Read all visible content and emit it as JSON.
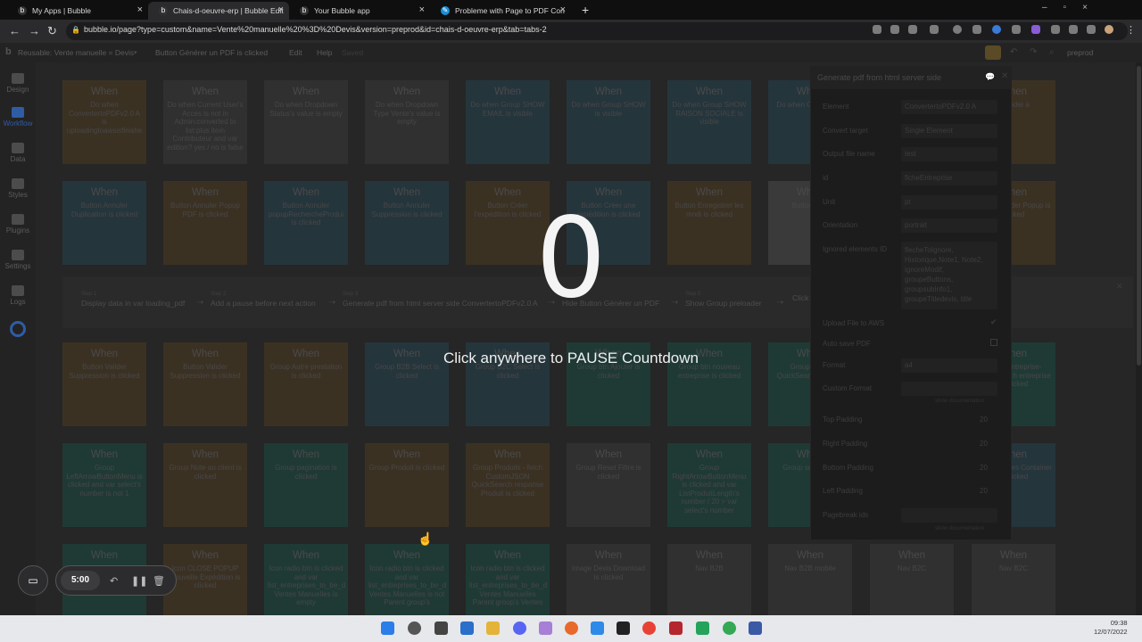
{
  "browser": {
    "tabs": [
      {
        "title": "My Apps | Bubble",
        "icon": "bubble-icon"
      },
      {
        "title": "Chais-d-oeuvre-erp | Bubble Edit",
        "icon": "bubble-icon"
      },
      {
        "title": "Your Bubble app",
        "icon": "bubble-icon"
      },
      {
        "title": "Probleme with Page to PDF Con",
        "icon": "forum-icon"
      }
    ],
    "url": "bubble.io/page?type=custom&name=Vente%20manuelle%20%3D%20Devis&version=preprod&id=chais-d-oeuvre-erp&tab=tabs-2"
  },
  "editor": {
    "reusable": "Reusable: Vente manuelle = Devis",
    "event_selector": "Button Générer un PDF is clicked",
    "menu": [
      "Edit",
      "Help",
      "Saved"
    ],
    "version": "preprod"
  },
  "sidebar": {
    "items": [
      "Design",
      "Workflow",
      "Data",
      "Styles",
      "Plugins",
      "Settings",
      "Logs"
    ]
  },
  "workflow": {
    "when_label": "When",
    "row1": [
      {
        "desc": "Do when ConvertertoPDFv2.0 A is uploadingtoawsisfinishe",
        "color": "orange"
      },
      {
        "desc": "Do when Current User's Acces is not in Admin:converted to list:plus item Contributeur and var edition? yes / no is false",
        "color": "grey"
      },
      {
        "desc": "Do when Dropdown Status's value is empty",
        "color": "grey"
      },
      {
        "desc": "Do when Dropdown Type Vente's value is empty",
        "color": "grey"
      },
      {
        "desc": "Do when Group SHOW EMAIL is visible",
        "color": "blue"
      },
      {
        "desc": "Do when Group SHOW is visible",
        "color": "blue"
      },
      {
        "desc": "Do when Group SHOW RAISON SOCIALE is visible",
        "color": "blue"
      },
      {
        "desc": "Do when G Ajouter is",
        "color": "blue"
      },
      {
        "desc": "",
        "color": "blue"
      },
      {
        "desc": "Accéder à",
        "color": "orange"
      }
    ],
    "row2": [
      {
        "desc": "Button Annuler Duplication is clicked",
        "color": "blue"
      },
      {
        "desc": "Button Annuler Popup PDF is clicked",
        "color": "orange"
      },
      {
        "desc": "Button Annuler popupRechercheProdui is clicked",
        "color": "blue"
      },
      {
        "desc": "Button Annuler Suppression is clicked",
        "color": "blue"
      },
      {
        "desc": "Button Créer l'expédition is clicked",
        "color": "orange"
      },
      {
        "desc": "Button Créer une expédition is clicked",
        "color": "blue"
      },
      {
        "desc": "Button Enregistrer les modi is clicked",
        "color": "orange"
      },
      {
        "desc": "Button Gén",
        "color": "dark"
      },
      {
        "desc": "",
        "color": "blue"
      },
      {
        "desc": "Button Valider Popup is clicked",
        "color": "orange"
      }
    ],
    "steps": [
      {
        "num": "Step 1",
        "name": "Display data in var loading_pdf"
      },
      {
        "num": "Step 2",
        "name": "Add a pause before next action"
      },
      {
        "num": "Step 3",
        "name": "Generate pdf from html server side ConvertertoPDFv2.0 A"
      },
      {
        "num": "Step 4",
        "name": "Hide Button Générer un PDF"
      },
      {
        "num": "Step 5",
        "name": "Show Group preloader"
      },
      {
        "num": "",
        "name": "Click"
      }
    ],
    "row3": [
      {
        "desc": "Button Valider Suppression is clicked",
        "color": "orange"
      },
      {
        "desc": "Button Valider Suppression is clicked",
        "color": "orange"
      },
      {
        "desc": "Group Autre prestation is clicked",
        "color": "orange"
      },
      {
        "desc": "Group B2B Select is clicked",
        "color": "blue"
      },
      {
        "desc": "Group B2C Select is clicked",
        "color": "blue"
      },
      {
        "desc": "Group btn Ajouter is clicked",
        "color": "teal"
      },
      {
        "desc": "Group btn nouveau entreprise is clicked",
        "color": "teal"
      },
      {
        "desc": "Group Client QuickSearch client is",
        "color": "teal"
      },
      {
        "desc": "",
        "color": "teal"
      },
      {
        "desc": "Group entreprise- QuickSearch entreprise is clicked",
        "color": "teal"
      }
    ],
    "row4": [
      {
        "desc": "Group LeftArrowButtonMenu is clicked and var select's number is not 1",
        "color": "teal"
      },
      {
        "desc": "Group Note au client is clicked",
        "color": "orange"
      },
      {
        "desc": "Group pagination is clicked",
        "color": "teal"
      },
      {
        "desc": "Group Produit is clicked",
        "color": "orange"
      },
      {
        "desc": "Group Produits - fetch CustomJSON QuickSearch response Produit is clicked",
        "color": "orange"
      },
      {
        "desc": "Group Reset Filtre is clicked",
        "color": "grey"
      },
      {
        "desc": "Group RightArrowButtonMenu is clicked and var ListProduitLength's number / 20 > var select's number",
        "color": "teal"
      },
      {
        "desc": "Group searchbox",
        "color": "teal"
      },
      {
        "desc": "",
        "color": "teal"
      },
      {
        "desc": "Group Ventes Container is clicked",
        "color": "blue"
      }
    ],
    "row5": [
      {
        "desc": "",
        "color": "teal"
      },
      {
        "desc": "Icon CLOSE POPUP Nouvelle Expédition is clicked",
        "color": "orange"
      },
      {
        "desc": "Icon radio btn is clicked and var list_entreprises_to_be_d Ventes Manuelles is empty",
        "color": "teal"
      },
      {
        "desc": "Icon radio btn is clicked and var list_entreprises_to_be_d Ventes Manuelles is not Parent group's",
        "color": "teal"
      },
      {
        "desc": "Icon radio btn is clicked and var list_entreprises_to_be_d Ventes Manuelles Parent group's Ventes",
        "color": "teal"
      },
      {
        "desc": "Image Devis Download is clicked",
        "color": "grey"
      },
      {
        "desc": "Nav B2B",
        "color": "grey"
      },
      {
        "desc": "Nav B2B mobile",
        "color": "grey"
      },
      {
        "desc": "Nav B2C",
        "color": "grey"
      },
      {
        "desc": "Nav B2C",
        "color": "grey"
      }
    ]
  },
  "panel": {
    "title": "Generate pdf from html server side",
    "rows": [
      {
        "label": "Element",
        "value": "ConvertertoPDFv2.0 A"
      },
      {
        "label": "Convert target",
        "value": "Single Element"
      },
      {
        "label": "Output file name",
        "value": "test"
      },
      {
        "label": "id",
        "value": "ficheEntreprise"
      },
      {
        "label": "Unit",
        "value": "pt"
      },
      {
        "label": "Orientation",
        "value": "portrait"
      },
      {
        "label": "Ignored elements ID",
        "value": "flecheToIgnore, Historique,Note1, Note2, ignoreModif, groupeButtons, groupsubInfo1, groupeTitledevis, title"
      },
      {
        "label": "Upload File to AWS",
        "value": ""
      },
      {
        "label": "Auto save PDF",
        "value": ""
      },
      {
        "label": "Format",
        "value": "a4"
      },
      {
        "label": "Custom Format",
        "value": ""
      },
      {
        "label": "Top Padding",
        "value": "20"
      },
      {
        "label": "Right Padding",
        "value": "20"
      },
      {
        "label": "Bottom Padding",
        "value": "20"
      },
      {
        "label": "Left Padding",
        "value": "20"
      },
      {
        "label": "Pagebreak ids",
        "value": ""
      }
    ],
    "show_doc": "show documentation"
  },
  "overlay": {
    "countdown": "0",
    "message": "Click anywhere to PAUSE Countdown"
  },
  "recorder": {
    "timer": "5:00"
  },
  "taskbar": {
    "time": "09:38",
    "date": "12/07/2022"
  },
  "colors": {
    "orange": "#3b3123",
    "blue": "#25353c",
    "teal": "#1f3a35",
    "grey": "#303030",
    "accent": "#2f5ca5"
  }
}
